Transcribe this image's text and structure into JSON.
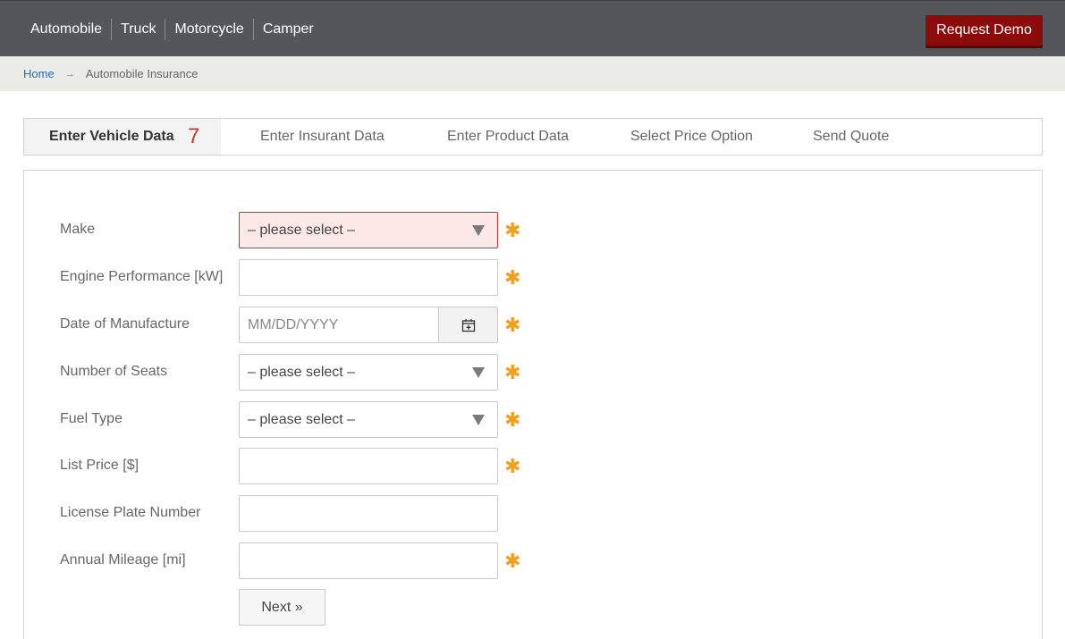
{
  "topnav": {
    "items": [
      "Automobile",
      "Truck",
      "Motorcycle",
      "Camper"
    ],
    "request_demo": "Request Demo"
  },
  "breadcrumb": {
    "home": "Home",
    "arrow": "→",
    "current": "Automobile Insurance"
  },
  "steps": {
    "items": [
      "Enter Vehicle Data",
      "Enter Insurant Data",
      "Enter Product Data",
      "Select Price Option",
      "Send Quote"
    ],
    "active_count": "7"
  },
  "form": {
    "make": {
      "label": "Make",
      "value": "– please select –"
    },
    "engine": {
      "label": "Engine Performance [kW]",
      "value": ""
    },
    "date": {
      "label": "Date of Manufacture",
      "placeholder": "MM/DD/YYYY"
    },
    "seats": {
      "label": "Number of Seats",
      "value": "– please select –"
    },
    "fuel": {
      "label": "Fuel Type",
      "value": "– please select –"
    },
    "price": {
      "label": "List Price [$]",
      "value": ""
    },
    "plate": {
      "label": "License Plate Number",
      "value": ""
    },
    "mileage": {
      "label": "Annual Mileage [mi]",
      "value": ""
    },
    "required_mark": "✱",
    "next": "Next »"
  },
  "colors": {
    "topbar": "#53565a",
    "accent": "#8b0b0b",
    "required": "#f0a020",
    "error_bg": "#fde8e8"
  }
}
